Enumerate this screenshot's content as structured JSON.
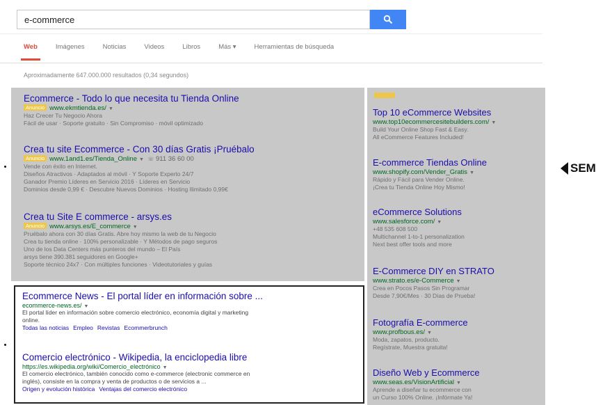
{
  "search": {
    "query": "e-commerce"
  },
  "tabs": [
    {
      "label": "Web",
      "active": true
    },
    {
      "label": "Imágenes"
    },
    {
      "label": "Noticias"
    },
    {
      "label": "Videos"
    },
    {
      "label": "Libros"
    },
    {
      "label": "Más ▾"
    },
    {
      "label": "Herramientas de búsqueda"
    }
  ],
  "result_stats": "Aproximadamente 647.000.000 resultados (0,34 segundos)",
  "ad_badge": "Anuncio",
  "main_ads": [
    {
      "title": "Ecommerce - Todo lo que necesita tu Tienda Online",
      "url": "www.ekmtienda.es/",
      "lines": [
        "Haz Crecer Tu Negocio Ahora",
        "Fácil de usar · Soporte gratuito · Sin Compromiso · móvil optimizado"
      ]
    },
    {
      "title": "Crea tu site Ecommerce - Con 30 días Gratis ¡Pruébalo",
      "url": "www.1and1.es/Tienda_Online",
      "phone": "911 36 60 00",
      "lines": [
        "Vende con éxito en Internet.",
        "Diseños Atractivos · Adaptados al móvil · Y Soporte Experto 24/7",
        "Ganador Premio Líderes en Servicio 2016 · Líderes en Servicio",
        "Dominios desde 0,99 € · Descubre Nuevos Dominios · Hosting Ilimitado 0,99€"
      ]
    },
    {
      "title": "Crea tu Site E commerce - arsys.es",
      "url": "www.arsys.es/E_commerce",
      "lines": [
        "Pruébalo ahora con 30 días Gratis. Abre hoy mismo la web de tu Negocio",
        "Crea tu tienda online · 100% personalizable · Y Métodos de pago seguros",
        "Uno de los Data Centers más punteros del mundo – El País",
        "arsys tiene 390.381 seguidores en Google+",
        "Soporte técnico 24x7 · Con múltiples funciones · Videotutoriales y guías"
      ]
    }
  ],
  "side_ads": [
    {
      "title": "Top 10 eCommerce Websites",
      "url": "www.top10ecommercesitebuilders.com/",
      "lines": [
        "Build Your Online Shop Fast & Easy.",
        "All eCommerce Features Included!"
      ]
    },
    {
      "title": "E-commerce Tiendas Online",
      "url": "www.shopify.com/Vender_Gratis",
      "lines": [
        "Rápido y Fácil para Vender Online.",
        "¡Crea tu Tienda Online Hoy Mismo!"
      ]
    },
    {
      "title": "eCommerce Solutions",
      "url": "www.salesforce.com/",
      "lines": [
        "+48 535 608 500",
        "Multichannel 1-to-1 personalization",
        "Next best offer tools and more"
      ]
    },
    {
      "title": "E-Commerce DIY en STRATO",
      "url": "www.strato.es/e-Commerce",
      "lines": [
        "Crea en Pocos Pasos Sin Programar",
        "Desde 7,90€/Mes · 30 Días de Prueba!"
      ]
    },
    {
      "title": "Fotografía E-commerce",
      "url": "www.profbous.es/",
      "lines": [
        "Moda, zapatos, producto.",
        "Regístrate, Muestra gratuita!"
      ]
    },
    {
      "title": "Diseño Web y Ecommerce",
      "url": "www.seas.es/VisionArtificial",
      "lines": [
        "Aprende a diseñar tu ecommerce con",
        "un Curso 100% Online. ¡Infórmate Ya!"
      ]
    }
  ],
  "organic": [
    {
      "title": "Ecommerce News - El portal líder en información sobre ...",
      "url": "ecommerce-news.es/",
      "snippet": [
        "El portal líder en información sobre comercio electrónico, economía digital y marketing",
        "online."
      ],
      "links": [
        "Todas las noticias",
        "Empleo",
        "Revistas",
        "Ecommerbrunch"
      ]
    },
    {
      "title": "Comercio electrónico - Wikipedia, la enciclopedia libre",
      "url": "https://es.wikipedia.org/wiki/Comercio_electrónico",
      "snippet": [
        "El comercio electrónico, también conocido como e-commerce (electronic commerce en",
        "inglés), consiste en la compra y venta de productos o de servicios a ..."
      ],
      "links": [
        "Origen y evolución histórica",
        "Ventajas del comercio electrónico"
      ]
    }
  ],
  "sem_label": "SEM"
}
